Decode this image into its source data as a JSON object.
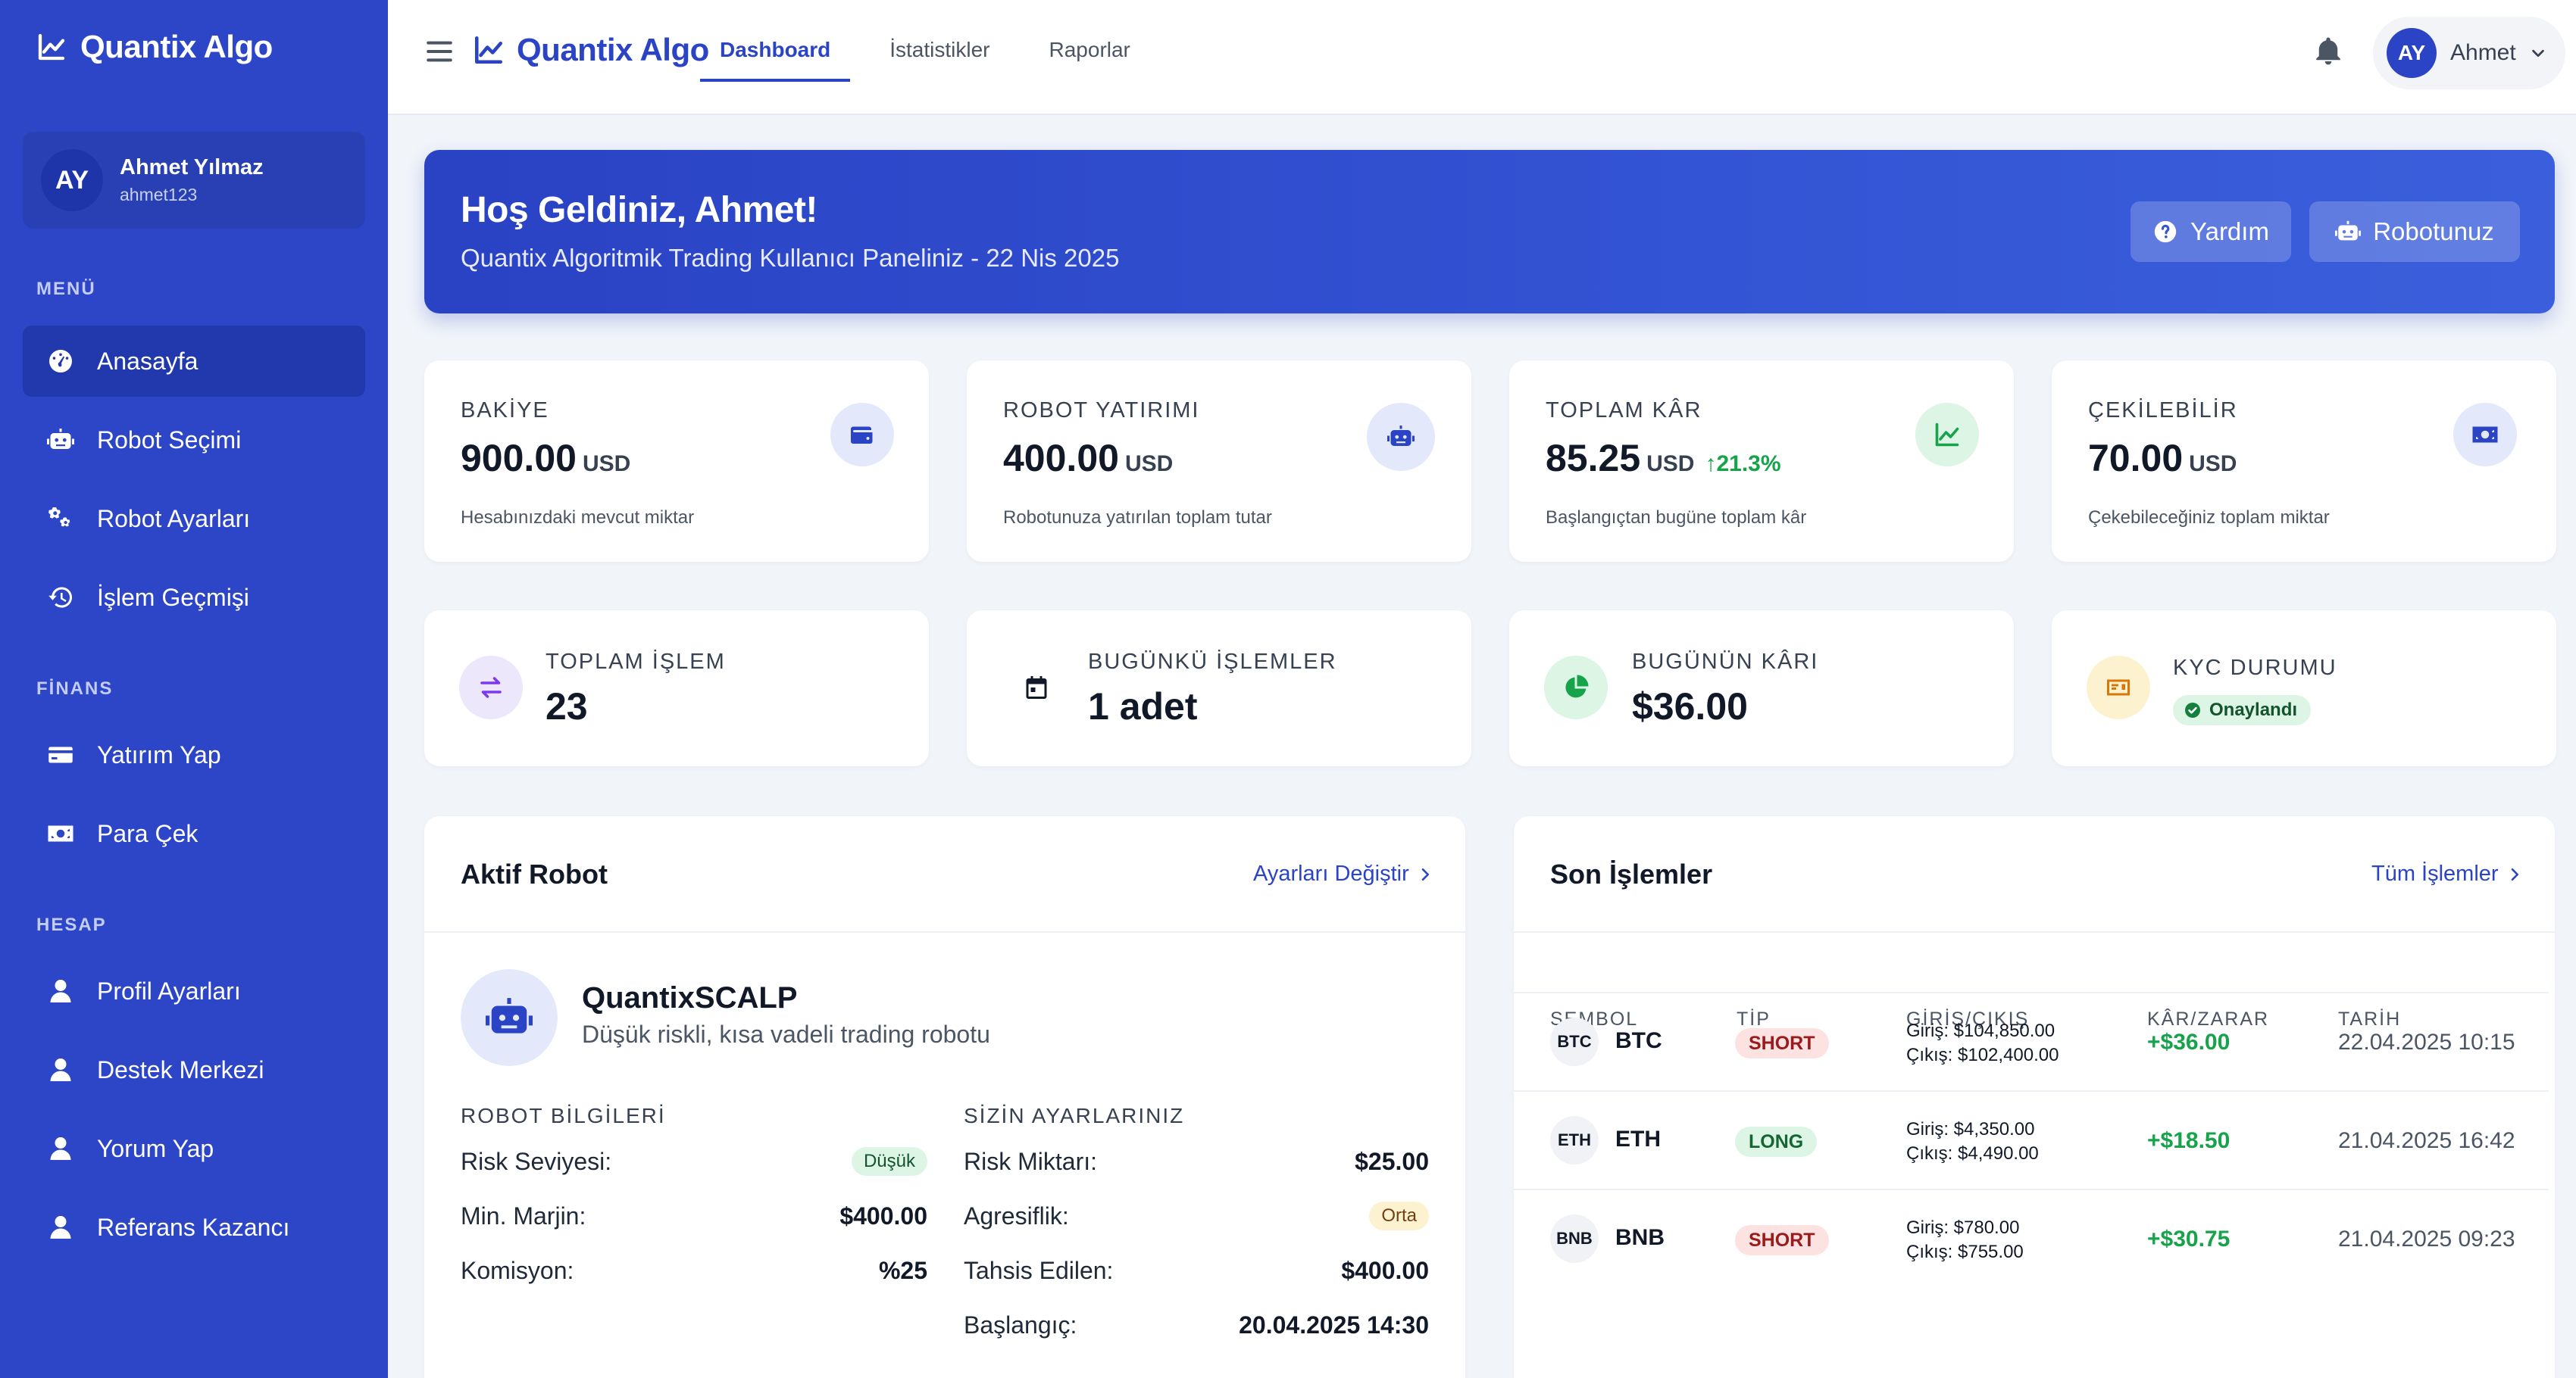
{
  "app": {
    "name": "Quantix Algo"
  },
  "sidebar": {
    "brand": "Quantix Algo",
    "user": {
      "initials": "AY",
      "name": "Ahmet Yılmaz",
      "handle": "ahmet123"
    },
    "sections": {
      "menu": "MENÜ",
      "finance": "FİNANS",
      "account": "HESAP"
    },
    "items": [
      {
        "label": "Anasayfa",
        "icon": "dashboard-gauge-icon"
      },
      {
        "label": "Robot Seçimi",
        "icon": "robot-icon"
      },
      {
        "label": "Robot Ayarları",
        "icon": "cogs-icon"
      },
      {
        "label": "İşlem Geçmişi",
        "icon": "history-icon"
      },
      {
        "label": "Yatırım Yap",
        "icon": "credit-card-icon"
      },
      {
        "label": "Para Çek",
        "icon": "money-bill-icon"
      },
      {
        "label": "Profil Ayarları",
        "icon": "user-icon"
      },
      {
        "label": "Destek Merkezi",
        "icon": "user-icon"
      },
      {
        "label": "Yorum Yap",
        "icon": "user-icon"
      },
      {
        "label": "Referans Kazancı",
        "icon": "user-icon"
      }
    ]
  },
  "header": {
    "brand": "Quantix Algo",
    "tabs": [
      {
        "label": "Dashboard",
        "active": true
      },
      {
        "label": "İstatistikler",
        "active": false
      },
      {
        "label": "Raporlar",
        "active": false
      }
    ],
    "user": {
      "initials": "AY",
      "name": "Ahmet"
    }
  },
  "banner": {
    "title": "Hoş Geldiniz, Ahmet!",
    "subtitle": "Quantix Algoritmik Trading Kullanıcı Paneliniz - 22 Nis 2025",
    "help_label": "Yardım",
    "robot_label": "Robotunuz"
  },
  "stats": [
    {
      "label": "BAKİYE",
      "value": "900.00",
      "unit": "USD",
      "desc": "Hesabınızdaki mevcut miktar",
      "icon": "wallet-icon"
    },
    {
      "label": "ROBOT YATIRIMI",
      "value": "400.00",
      "unit": "USD",
      "desc": "Robotunuza yatırılan toplam tutar",
      "icon": "robot-icon"
    },
    {
      "label": "TOPLAM KÂR",
      "value": "85.25",
      "unit": "USD",
      "change": "21.3%",
      "desc": "Başlangıçtan bugüne toplam kâr",
      "icon": "chart-line-icon"
    },
    {
      "label": "ÇEKİLEBİLİR",
      "value": "70.00",
      "unit": "USD",
      "desc": "Çekebileceğiniz toplam miktar",
      "icon": "money-bill-icon"
    }
  ],
  "stats2": [
    {
      "label": "TOPLAM İŞLEM",
      "value": "23",
      "icon": "exchange-icon"
    },
    {
      "label": "BUGÜNKÜ İŞLEMLER",
      "value": "1 adet",
      "icon": "calendar-icon"
    },
    {
      "label": "BUGÜNÜN KÂRI",
      "value": "$36.00",
      "icon": "pie-chart-icon"
    },
    {
      "label": "KYC DURUMU",
      "badge": "Onaylandı",
      "icon": "id-card-icon"
    }
  ],
  "active_robot": {
    "title": "Aktif Robot",
    "link": "Ayarları Değiştir",
    "name": "QuantixSCALP",
    "description": "Düşük riskli, kısa vadeli trading robotu",
    "info_heading": "ROBOT BİLGİLERİ",
    "info": [
      {
        "key": "Risk Seviyesi:",
        "value": "Düşük"
      },
      {
        "key": "Min. Marjin:",
        "value": "$400.00"
      },
      {
        "key": "Komisyon:",
        "value": "%25"
      }
    ],
    "settings_heading": "SİZİN AYARLARINIZ",
    "settings": [
      {
        "key": "Risk Miktarı:",
        "value": "$25.00"
      },
      {
        "key": "Agresiflik:",
        "value": "Orta"
      },
      {
        "key": "Tahsis Edilen:",
        "value": "$400.00"
      },
      {
        "key": "Başlangıç:",
        "value": "20.04.2025 14:30"
      }
    ]
  },
  "recent_trades": {
    "title": "Son İşlemler",
    "link": "Tüm İşlemler",
    "columns": [
      "SEMBOL",
      "TİP",
      "GİRİŞ/ÇIKIŞ",
      "KÂR/ZARAR",
      "TARİH"
    ],
    "rows": [
      {
        "coin": "BTC",
        "symbol": "BTC",
        "type": "SHORT",
        "entry": "Giriş: $104,850.00",
        "exit": "Çıkış: $102,400.00",
        "pnl": "+$36.00",
        "date": "22.04.2025 10:15"
      },
      {
        "coin": "ETH",
        "symbol": "ETH",
        "type": "LONG",
        "entry": "Giriş: $4,350.00",
        "exit": "Çıkış: $4,490.00",
        "pnl": "+$18.50",
        "date": "21.04.2025 16:42"
      },
      {
        "coin": "BNB",
        "symbol": "BNB",
        "type": "SHORT",
        "entry": "Giriş: $780.00",
        "exit": "Çıkış: $755.00",
        "pnl": "+$30.75",
        "date": "21.04.2025 09:23"
      }
    ]
  },
  "colors": {
    "primary": "#2d45c7",
    "success": "#16a34a",
    "danger": "#991b1b"
  }
}
